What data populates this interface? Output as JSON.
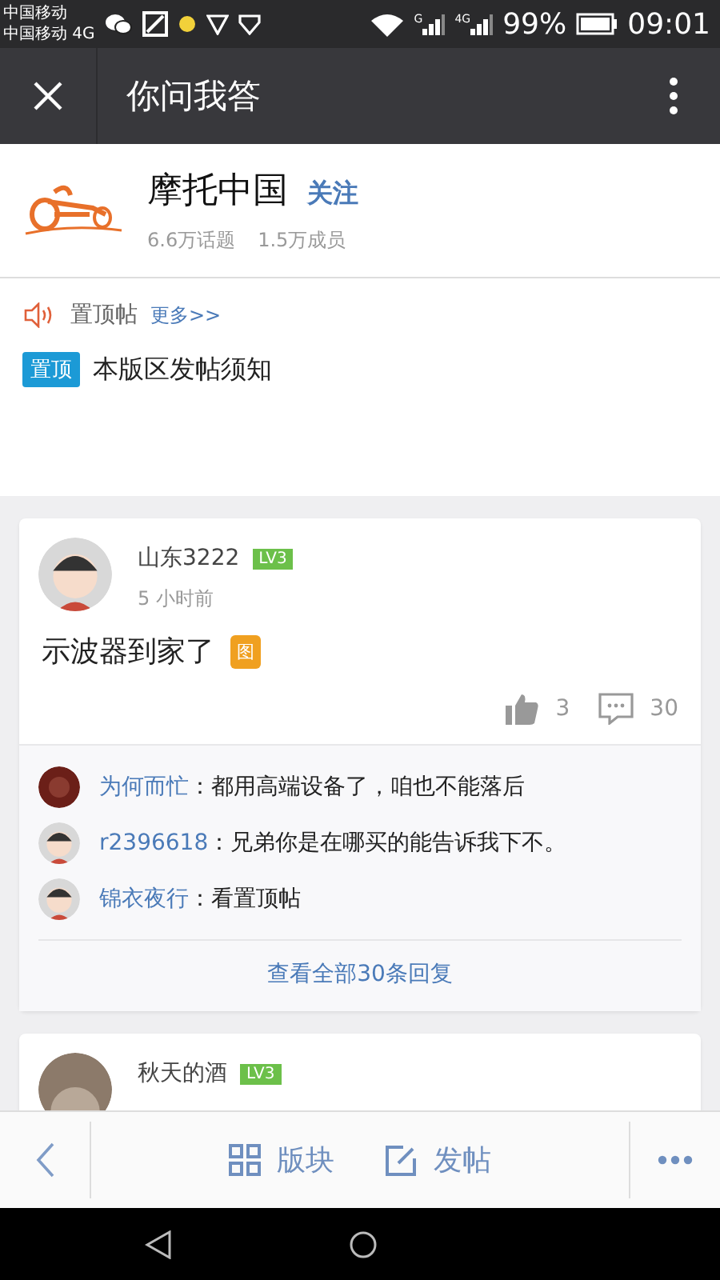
{
  "status_bar": {
    "carrier_1": "中国移动",
    "carrier_2": "中国移动 4G",
    "signal_1_label": "G",
    "signal_2_label": "4G",
    "battery": "99%",
    "time": "09:01"
  },
  "app_bar": {
    "title": "你问我答"
  },
  "forum": {
    "name": "摩托中国",
    "follow": "关注",
    "topics": "6.6万话题",
    "members": "1.5万成员"
  },
  "pinned": {
    "label": "置顶帖",
    "more": "更多>>",
    "items": [
      {
        "tag": "置顶",
        "title": "本版区发帖须知"
      }
    ]
  },
  "posts": [
    {
      "author": "山东3222",
      "level": "LV3",
      "time": "5 小时前",
      "title": "示波器到家了",
      "image_tag": "图",
      "likes": "3",
      "comments": "30",
      "replies": [
        {
          "user": "为何而忙",
          "text": "：都用高端设备了，咱也不能落后",
          "kind": "dark"
        },
        {
          "user": "r2396618",
          "text": "：兄弟你是在哪买的能告诉我下不。",
          "kind": "cartoon"
        },
        {
          "user": "锦衣夜行",
          "text": "：看置顶帖",
          "kind": "cartoon"
        }
      ],
      "view_all": "查看全部30条回复"
    },
    {
      "author": "秋天的酒",
      "level": "LV3"
    }
  ],
  "toolbar": {
    "sections": "版块",
    "post": "发帖"
  }
}
